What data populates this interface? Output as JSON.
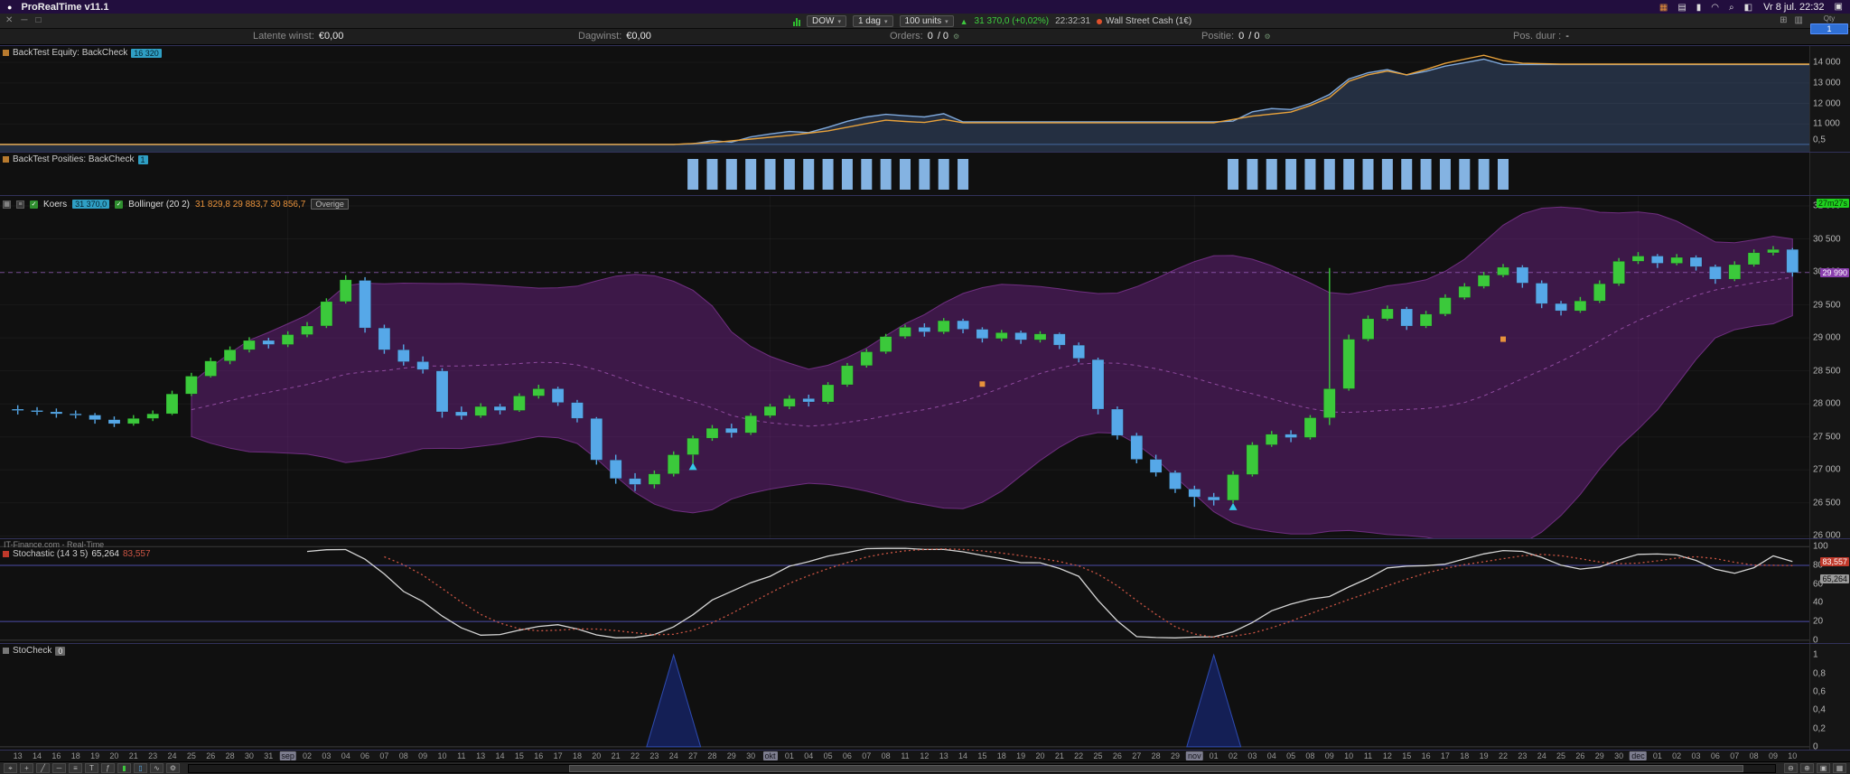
{
  "menubar": {
    "app_title": "ProRealTime v11.1",
    "clock": "Vr 8 jul. 22:32",
    "status_icons": [
      {
        "name": "app-icon",
        "glyph": "▦",
        "color": "#e8923b"
      },
      {
        "name": "display-icon",
        "glyph": "▤",
        "color": "#ddd"
      },
      {
        "name": "battery-icon",
        "glyph": "▮",
        "color": "#ddd"
      },
      {
        "name": "wifi-icon",
        "glyph": "◠",
        "color": "#ddd"
      },
      {
        "name": "search-icon",
        "glyph": "⌕",
        "color": "#ddd"
      },
      {
        "name": "control-center-icon",
        "glyph": "◧",
        "color": "#ddd"
      }
    ],
    "notification_icon": "▣"
  },
  "toolbar": {
    "window": {
      "close": "✕",
      "minimize": "─",
      "maximize": "□"
    },
    "symbol": "DOW",
    "timeframe": "1 dag",
    "units": "100 units",
    "price": "31 370,0 (+0,02%)",
    "time": "22:32:31",
    "instrument": "Wall Street Cash (1€)",
    "right_icons": [
      {
        "name": "link-icon",
        "glyph": "⊞"
      },
      {
        "name": "workspace-icon",
        "glyph": "▥"
      }
    ],
    "qty_label": "Qty",
    "qty_value": "1"
  },
  "infobar": {
    "items": [
      {
        "label": "Latente winst:",
        "value": "€0,00"
      },
      {
        "label": "Dagwinst:",
        "value": "€0,00"
      },
      {
        "label": "Orders:",
        "value": "0",
        "value2": "/ 0"
      },
      {
        "label": "Positie:",
        "value": "0",
        "value2": "/ 0"
      },
      {
        "label": "Pos. duur :",
        "value": "-"
      }
    ]
  },
  "panels": {
    "equity": {
      "title": "BackTest Equity: BackCheck",
      "badge": "16 320",
      "axis": [
        "14 000",
        "13 000",
        "12 000",
        "11 000",
        "0,5"
      ]
    },
    "positions": {
      "title": "BackTest Posities: BackCheck",
      "badge": "1"
    },
    "main": {
      "legend": {
        "koers_label": "Koers",
        "koers_value": "31 370,0",
        "bollinger_label": "Bollinger (20 2)",
        "bollinger_values": "31 829,8  29 883,7  30 856,7",
        "overige": "Overige"
      },
      "countdown": "27m27s",
      "price_badge": "29 990",
      "axis": [
        "31 000",
        "30 500",
        "30 000",
        "29 500",
        "29 000",
        "28 500",
        "28 000",
        "27 500",
        "27 000",
        "26 500",
        "26 000"
      ]
    },
    "stochastic": {
      "watermark": "IT-Finance.com - Real-Time",
      "title": "Stochastic (14 3 5)",
      "k_value": "65,264",
      "d_value": "83,557",
      "axis": [
        "100",
        "80",
        "60",
        "40",
        "20",
        "0"
      ]
    },
    "stocheck": {
      "title": "StoCheck",
      "badge": "0",
      "axis": [
        "1",
        "0,8",
        "0,6",
        "0,4",
        "0,2",
        "0"
      ]
    }
  },
  "bottombar": {
    "tools": [
      {
        "name": "cursor-tool-icon",
        "glyph": "⌖",
        "color": "#bbb"
      },
      {
        "name": "crosshair-tool-icon",
        "glyph": "+",
        "color": "#bbb"
      },
      {
        "name": "trendline-tool-icon",
        "glyph": "╱",
        "color": "#bbb"
      },
      {
        "name": "horizontal-line-tool-icon",
        "glyph": "─",
        "color": "#bbb"
      },
      {
        "name": "fibonacci-tool-icon",
        "glyph": "≡",
        "color": "#bbb"
      },
      {
        "name": "text-tool-icon",
        "glyph": "T",
        "color": "#bbb"
      },
      {
        "name": "indicator-icon",
        "glyph": "ƒ",
        "color": "#bbb"
      },
      {
        "name": "candlestick-view-icon",
        "glyph": "▮",
        "color": "#3ec93e"
      },
      {
        "name": "bar-view-icon",
        "glyph": "▯",
        "color": "#56a8e8"
      },
      {
        "name": "line-view-icon",
        "glyph": "∿",
        "color": "#bbb"
      },
      {
        "name": "settings-icon",
        "glyph": "⚙",
        "color": "#bbb"
      }
    ],
    "zoom_icons": [
      {
        "name": "zoom-out-icon",
        "glyph": "⊖"
      },
      {
        "name": "zoom-in-icon",
        "glyph": "⊕"
      },
      {
        "name": "fit-screen-icon",
        "glyph": "▣"
      },
      {
        "name": "layout-icon",
        "glyph": "▦"
      }
    ]
  },
  "chart_data": {
    "type": "candlestick",
    "instrument": "Wall Street Cash (1€)",
    "timeframe": "1 dag",
    "ylim": [
      25950,
      31150
    ],
    "price_line": 29990,
    "bollinger": {
      "period": 20,
      "deviations": 2
    },
    "stochastic": {
      "k_period": 14,
      "k_smooth": 3,
      "d_period": 5,
      "k_last": 65.264,
      "d_last": 83.557
    },
    "stoch_ylim": [
      -4,
      108
    ],
    "dates": [
      "13",
      "14",
      "16",
      "18",
      "19",
      "20",
      "21",
      "23",
      "24",
      "25",
      "26",
      "28",
      "30",
      "31",
      "sep",
      "02",
      "03",
      "04",
      "06",
      "07",
      "08",
      "09",
      "10",
      "11",
      "13",
      "14",
      "15",
      "16",
      "17",
      "18",
      "20",
      "21",
      "22",
      "23",
      "24",
      "27",
      "28",
      "29",
      "30",
      "okt",
      "01",
      "04",
      "05",
      "06",
      "07",
      "08",
      "11",
      "12",
      "13",
      "14",
      "15",
      "18",
      "19",
      "20",
      "21",
      "22",
      "25",
      "26",
      "27",
      "28",
      "29",
      "nov",
      "01",
      "02",
      "03",
      "04",
      "05",
      "08",
      "09",
      "10",
      "11",
      "12",
      "15",
      "16",
      "17",
      "18",
      "19",
      "22",
      "23",
      "24",
      "25",
      "26",
      "29",
      "30",
      "dec",
      "01",
      "02",
      "03",
      "06",
      "07",
      "08",
      "09",
      "10"
    ],
    "ohlc": [
      [
        27920,
        27980,
        27840,
        27900
      ],
      [
        27900,
        27950,
        27830,
        27880
      ],
      [
        27880,
        27930,
        27790,
        27850
      ],
      [
        27850,
        27900,
        27780,
        27830
      ],
      [
        27830,
        27860,
        27700,
        27760
      ],
      [
        27760,
        27810,
        27650,
        27700
      ],
      [
        27700,
        27830,
        27670,
        27780
      ],
      [
        27780,
        27900,
        27740,
        27850
      ],
      [
        27850,
        28200,
        27830,
        28150
      ],
      [
        28150,
        28470,
        28120,
        28420
      ],
      [
        28420,
        28700,
        28400,
        28650
      ],
      [
        28650,
        28870,
        28600,
        28820
      ],
      [
        28820,
        29010,
        28780,
        28960
      ],
      [
        28960,
        29000,
        28840,
        28900
      ],
      [
        28900,
        29100,
        28860,
        29050
      ],
      [
        29050,
        29240,
        29010,
        29180
      ],
      [
        29180,
        29600,
        29150,
        29550
      ],
      [
        29550,
        29950,
        29520,
        29880
      ],
      [
        29870,
        29920,
        29080,
        29150
      ],
      [
        29150,
        29200,
        28760,
        28820
      ],
      [
        28820,
        28900,
        28580,
        28640
      ],
      [
        28640,
        28720,
        28460,
        28520
      ],
      [
        28500,
        28540,
        27790,
        27880
      ],
      [
        27880,
        27960,
        27760,
        27820
      ],
      [
        27820,
        28010,
        27790,
        27960
      ],
      [
        27960,
        28000,
        27840,
        27900
      ],
      [
        27900,
        28160,
        27880,
        28120
      ],
      [
        28120,
        28290,
        28080,
        28230
      ],
      [
        28230,
        28260,
        27970,
        28020
      ],
      [
        28020,
        28060,
        27720,
        27780
      ],
      [
        27780,
        27800,
        27080,
        27150
      ],
      [
        27150,
        27230,
        26790,
        26870
      ],
      [
        26870,
        26950,
        26680,
        26780
      ],
      [
        26780,
        26990,
        26720,
        26940
      ],
      [
        26940,
        27280,
        26900,
        27230
      ],
      [
        27230,
        27520,
        27100,
        27480
      ],
      [
        27480,
        27680,
        27440,
        27630
      ],
      [
        27630,
        27700,
        27490,
        27560
      ],
      [
        27560,
        27860,
        27530,
        27820
      ],
      [
        27820,
        28000,
        27790,
        27960
      ],
      [
        27960,
        28130,
        27920,
        28080
      ],
      [
        28080,
        28140,
        27960,
        28030
      ],
      [
        28030,
        28330,
        28000,
        28290
      ],
      [
        28290,
        28620,
        28260,
        28580
      ],
      [
        28580,
        28830,
        28550,
        28790
      ],
      [
        28790,
        29060,
        28760,
        29020
      ],
      [
        29020,
        29200,
        28990,
        29160
      ],
      [
        29160,
        29220,
        29020,
        29090
      ],
      [
        29090,
        29300,
        29060,
        29260
      ],
      [
        29260,
        29290,
        29070,
        29130
      ],
      [
        29130,
        29160,
        28930,
        28990
      ],
      [
        28990,
        29120,
        28950,
        29080
      ],
      [
        29080,
        29110,
        28910,
        28970
      ],
      [
        28970,
        29100,
        28930,
        29060
      ],
      [
        29060,
        29080,
        28830,
        28890
      ],
      [
        28890,
        28930,
        28630,
        28690
      ],
      [
        28670,
        28700,
        27840,
        27920
      ],
      [
        27920,
        27960,
        27460,
        27520
      ],
      [
        27520,
        27560,
        27100,
        27160
      ],
      [
        27160,
        27230,
        26900,
        26960
      ],
      [
        26960,
        26990,
        26650,
        26710
      ],
      [
        26710,
        26760,
        26440,
        26590
      ],
      [
        26590,
        26650,
        26460,
        26540
      ],
      [
        26540,
        26980,
        26500,
        26930
      ],
      [
        26930,
        27420,
        26900,
        27380
      ],
      [
        27380,
        27590,
        27350,
        27540
      ],
      [
        27540,
        27600,
        27420,
        27490
      ],
      [
        27490,
        27830,
        27460,
        27790
      ],
      [
        27790,
        30060,
        27680,
        28230
      ],
      [
        28230,
        29050,
        28200,
        28980
      ],
      [
        28980,
        29340,
        28950,
        29290
      ],
      [
        29290,
        29490,
        29260,
        29440
      ],
      [
        29440,
        29470,
        29120,
        29180
      ],
      [
        29180,
        29410,
        29150,
        29360
      ],
      [
        29360,
        29660,
        29330,
        29610
      ],
      [
        29610,
        29830,
        29580,
        29780
      ],
      [
        29780,
        30000,
        29750,
        29950
      ],
      [
        29950,
        30120,
        29920,
        30070
      ],
      [
        30070,
        30100,
        29760,
        29830
      ],
      [
        29830,
        29870,
        29450,
        29520
      ],
      [
        29520,
        29560,
        29340,
        29410
      ],
      [
        29410,
        29620,
        29380,
        29560
      ],
      [
        29560,
        29870,
        29530,
        29820
      ],
      [
        29820,
        30210,
        29790,
        30160
      ],
      [
        30160,
        30300,
        30120,
        30240
      ],
      [
        30240,
        30270,
        30060,
        30130
      ],
      [
        30130,
        30270,
        30100,
        30220
      ],
      [
        30220,
        30250,
        30020,
        30080
      ],
      [
        30080,
        30110,
        29820,
        29890
      ],
      [
        29890,
        30160,
        29860,
        30110
      ],
      [
        30110,
        30340,
        30080,
        30290
      ],
      [
        30290,
        30390,
        30250,
        30340
      ],
      [
        30340,
        30360,
        29930,
        29990
      ]
    ],
    "equity": {
      "start": 10000,
      "final_badge": 16320,
      "ylim": [
        9600,
        14800
      ],
      "line_blue": [
        [
          0,
          10000
        ],
        [
          34,
          10000
        ],
        [
          35,
          10030
        ],
        [
          36,
          10180
        ],
        [
          37,
          10110
        ],
        [
          38,
          10370
        ],
        [
          39,
          10510
        ],
        [
          40,
          10630
        ],
        [
          41,
          10580
        ],
        [
          42,
          10840
        ],
        [
          43,
          11130
        ],
        [
          44,
          11340
        ],
        [
          45,
          11470
        ],
        [
          46,
          11400
        ],
        [
          47,
          11340
        ],
        [
          48,
          11500
        ],
        [
          49,
          11100
        ],
        [
          62,
          11100
        ],
        [
          63,
          11140
        ],
        [
          64,
          11590
        ],
        [
          65,
          11750
        ],
        [
          66,
          11700
        ],
        [
          67,
          12000
        ],
        [
          68,
          12440
        ],
        [
          69,
          13190
        ],
        [
          70,
          13500
        ],
        [
          71,
          13650
        ],
        [
          72,
          13390
        ],
        [
          73,
          13570
        ],
        [
          74,
          13820
        ],
        [
          75,
          13990
        ],
        [
          76,
          14160
        ],
        [
          77,
          13900
        ],
        [
          92,
          13900
        ]
      ],
      "line_orange": [
        [
          0,
          10000
        ],
        [
          34,
          10000
        ],
        [
          36,
          10090
        ],
        [
          38,
          10260
        ],
        [
          40,
          10440
        ],
        [
          42,
          10660
        ],
        [
          44,
          11020
        ],
        [
          45,
          11180
        ],
        [
          46,
          11120
        ],
        [
          47,
          11070
        ],
        [
          48,
          11220
        ],
        [
          49,
          11060
        ],
        [
          62,
          11060
        ],
        [
          64,
          11380
        ],
        [
          66,
          11580
        ],
        [
          67,
          11900
        ],
        [
          68,
          12290
        ],
        [
          69,
          13080
        ],
        [
          70,
          13400
        ],
        [
          71,
          13580
        ],
        [
          72,
          13400
        ],
        [
          73,
          13660
        ],
        [
          74,
          13960
        ],
        [
          75,
          14160
        ],
        [
          76,
          14350
        ],
        [
          77,
          14100
        ],
        [
          78,
          13960
        ],
        [
          80,
          13920
        ],
        [
          92,
          13920
        ]
      ]
    },
    "positions": {
      "value": 1,
      "ranges": [
        [
          35,
          49
        ],
        [
          63,
          77
        ]
      ]
    },
    "trades": {
      "buy_arrows": [
        {
          "index": 35,
          "price": 27040
        },
        {
          "index": 63,
          "price": 26430
        }
      ],
      "exit_markers": [
        {
          "index": 50,
          "price": 28300
        },
        {
          "index": 77,
          "price": 28980
        }
      ]
    },
    "stocheck": {
      "ylim": [
        -0.04,
        1.12
      ],
      "spikes": [
        34,
        62
      ]
    },
    "colors": {
      "up": "#3bc93b",
      "down": "#56a8e8",
      "bollinger_fill": "rgba(125,35,150,0.42)",
      "bollinger_edge": "rgba(170,70,195,0.55)",
      "bollinger_mid": "rgba(200,110,220,0.6)",
      "equity_line": "#7fa9dc",
      "equity_fill": "rgba(90,130,195,0.28)",
      "equity_benchmark": "#e8a23b",
      "positions_bar": "#84b3e2",
      "stoch_k": "#d5d5d5",
      "stoch_d": "#cc5544",
      "spike_fill": "#141f55",
      "spike_edge": "#2e4bb0"
    }
  }
}
